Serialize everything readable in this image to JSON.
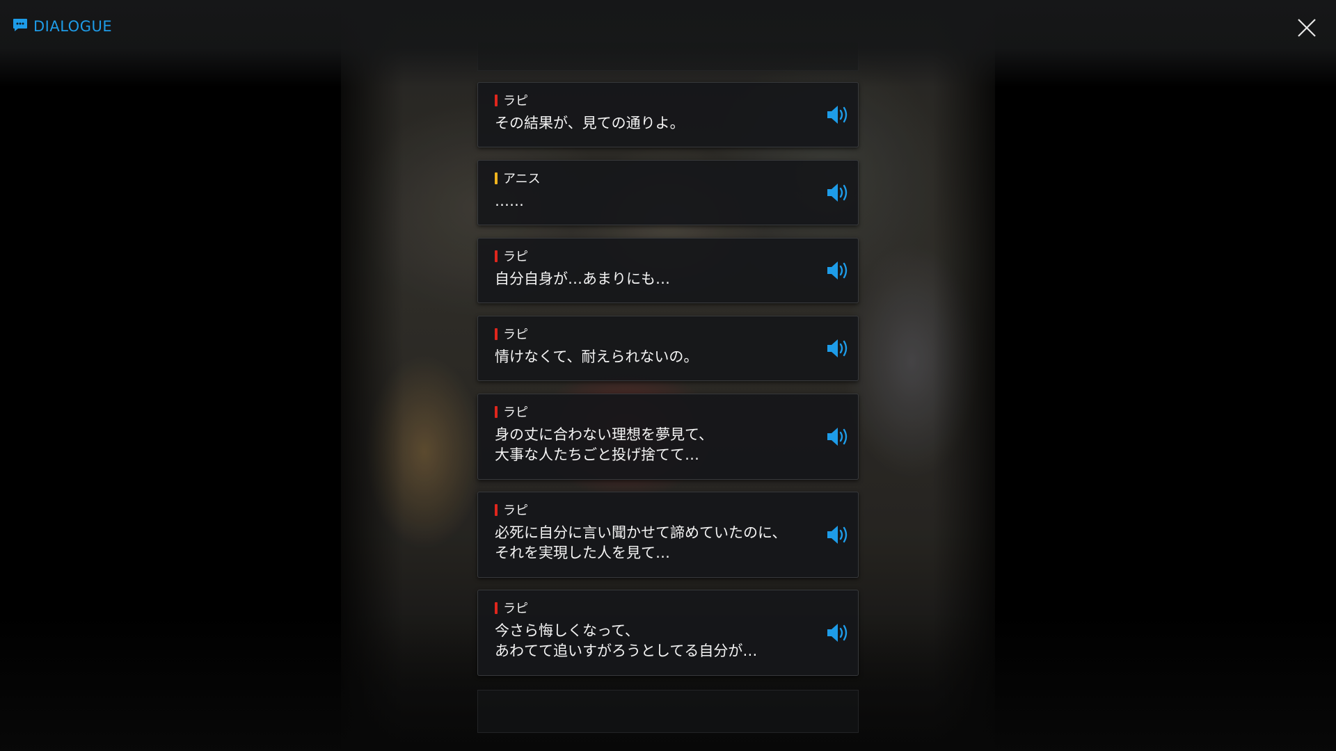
{
  "header": {
    "title": "DIALOGUE",
    "accent_color": "#1e9ce8",
    "icon": "chat-bubble-icon"
  },
  "close_icon": "close-icon",
  "voice_icon": "speaker-volume-icon",
  "dialogue": [
    {
      "speaker": "ラピ",
      "speaker_color": "#e0261d",
      "text": "その結果が、見ての通りよ。"
    },
    {
      "speaker": "アニス",
      "speaker_color": "#f0b41e",
      "text": "……"
    },
    {
      "speaker": "ラピ",
      "speaker_color": "#e0261d",
      "text": "自分自身が…あまりにも…"
    },
    {
      "speaker": "ラピ",
      "speaker_color": "#e0261d",
      "text": "情けなくて、耐えられないの。"
    },
    {
      "speaker": "ラピ",
      "speaker_color": "#e0261d",
      "text": "身の丈に合わない理想を夢見て、\n大事な人たちごと投げ捨てて…"
    },
    {
      "speaker": "ラピ",
      "speaker_color": "#e0261d",
      "text": "必死に自分に言い聞かせて諦めていたのに、\nそれを実現した人を見て…"
    },
    {
      "speaker": "ラピ",
      "speaker_color": "#e0261d",
      "text": "今さら悔しくなって、\nあわてて追いすがろうとしてる自分が…"
    }
  ]
}
